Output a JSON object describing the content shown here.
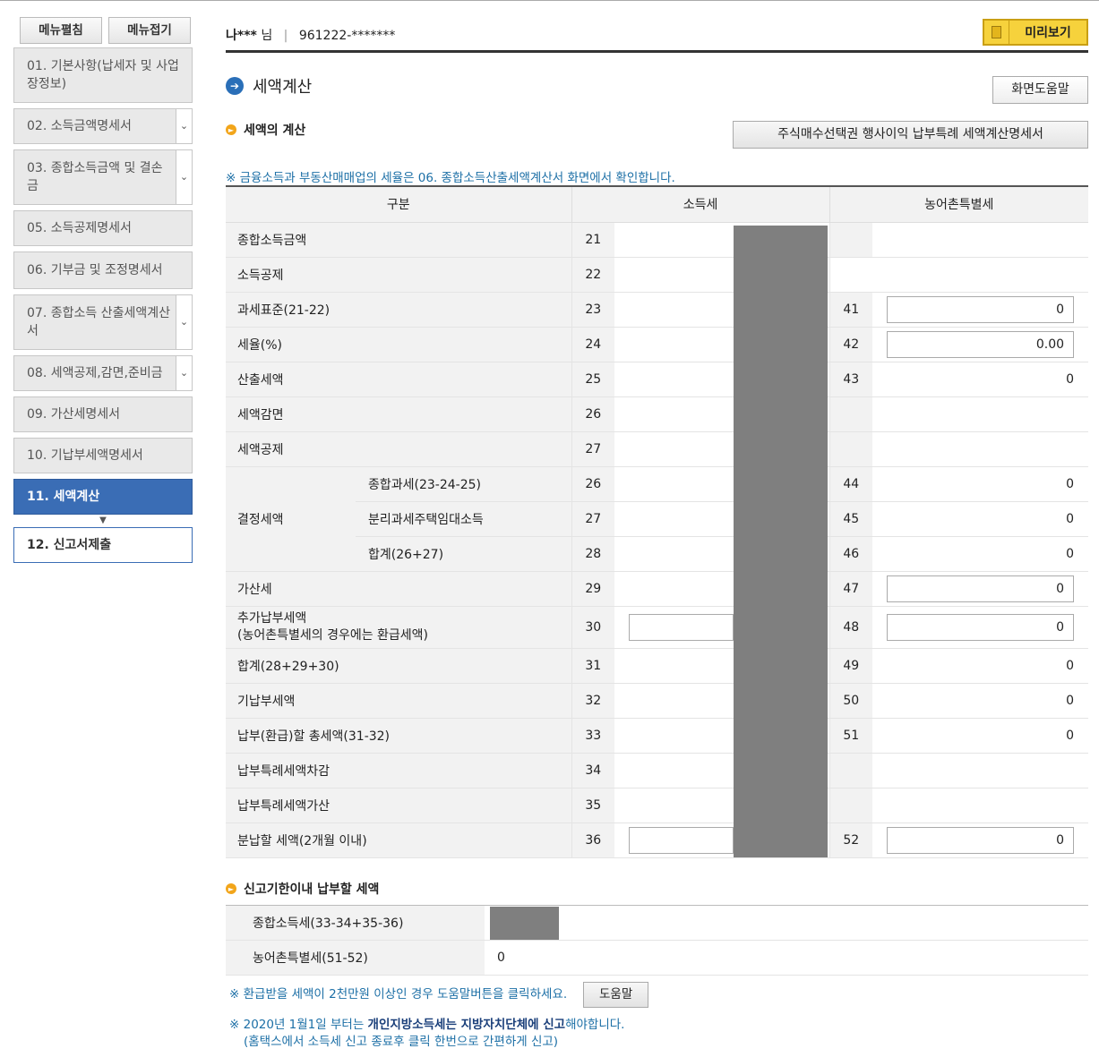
{
  "sidebar": {
    "expand_label": "메뉴펼침",
    "collapse_label": "메뉴접기",
    "items": [
      {
        "label": "01. 기본사항(납세자 및 사업장정보)"
      },
      {
        "label": "02. 소득금액명세서"
      },
      {
        "label": "03. 종합소득금액 및 결손금"
      },
      {
        "label": "05. 소득공제명세서"
      },
      {
        "label": "06. 기부금 및 조정명세서"
      },
      {
        "label": "07. 종합소득 산출세액계산서"
      },
      {
        "label": "08. 세액공제,감면,준비금"
      },
      {
        "label": "09. 가산세명세서"
      },
      {
        "label": "10. 기납부세액명세서"
      },
      {
        "label": "11. 세액계산"
      },
      {
        "label": "12. 신고서제출"
      }
    ]
  },
  "header": {
    "user_name": "나***",
    "honorific": "님",
    "resident_id": "961222-*******",
    "preview_label": "미리보기"
  },
  "page": {
    "title": "세액계산",
    "help_button": "화면도움말"
  },
  "section_tax_calc": {
    "title": "세액의 계산",
    "stock_option_button": "주식매수선택권 행사이익 납부특례 세액계산명세서",
    "notice": "※ 금융소득과 부동산매매업의 세율은 06. 종합소득산출세액계산서 화면에서 확인합니다.",
    "headers": {
      "category": "구분",
      "income_tax": "소득세",
      "rural_tax": "농어촌특별세"
    },
    "rows": {
      "r21": {
        "label": "종합소득금액",
        "num": "21"
      },
      "r22": {
        "label": "소득공제",
        "num": "22"
      },
      "r23": {
        "label": "과세표준(21-22)",
        "num": "23",
        "rnum": "41",
        "rval": "0"
      },
      "r24": {
        "label": "세율(%)",
        "num": "24",
        "rnum": "42",
        "rval": "0.00"
      },
      "r25": {
        "label": "산출세액",
        "num": "25",
        "rnum": "43",
        "rval": "0"
      },
      "r26a": {
        "label": "세액감면",
        "num": "26"
      },
      "r27a": {
        "label": "세액공제",
        "num": "27"
      },
      "decision_label": "결정세액",
      "r26b": {
        "label": "종합과세(23-24-25)",
        "num": "26",
        "rnum": "44",
        "rval": "0"
      },
      "r27b": {
        "label": "분리과세주택임대소득",
        "num": "27",
        "rnum": "45",
        "rval": "0"
      },
      "r28": {
        "label": "합계(26+27)",
        "num": "28",
        "rnum": "46",
        "rval": "0"
      },
      "r29": {
        "label": "가산세",
        "num": "29",
        "rnum": "47",
        "rval": "0"
      },
      "r30": {
        "label": "추가납부세액",
        "label2": "(농어촌특별세의 경우에는 환급세액)",
        "num": "30",
        "rnum": "48",
        "rval": "0"
      },
      "r31": {
        "label": "합계(28+29+30)",
        "num": "31",
        "rnum": "49",
        "rval": "0"
      },
      "r32": {
        "label": "기납부세액",
        "num": "32",
        "rnum": "50",
        "rval": "0"
      },
      "r33": {
        "label": "납부(환급)할 총세액(31-32)",
        "num": "33",
        "rnum": "51",
        "rval": "0"
      },
      "r34": {
        "label": "납부특례세액차감",
        "num": "34"
      },
      "r35": {
        "label": "납부특례세액가산",
        "num": "35"
      },
      "r36": {
        "label": "분납할 세액(2개월 이내)",
        "num": "36",
        "rnum": "52",
        "rval": "0"
      }
    }
  },
  "section_deadline": {
    "title": "신고기한이내 납부할 세액",
    "income_label": "종합소득세(33-34+35-36)",
    "rural_label": "농어촌특별세(51-52)",
    "rural_value": "0"
  },
  "notes": {
    "refund_note": "※ 환급받을 세액이 2천만원 이상인 경우 도움말버튼을 클릭하세요.",
    "help_button": "도움말",
    "local_tax_prefix": "※ 2020년 1월1일 부터는 ",
    "local_tax_bold": "개인지방소득세는 지방자치단체에 신고",
    "local_tax_suffix": "해야합니다.",
    "local_tax_sub": "(홈택스에서 소득세 신고 종료후 클릭 한번으로 간편하게 신고)"
  }
}
